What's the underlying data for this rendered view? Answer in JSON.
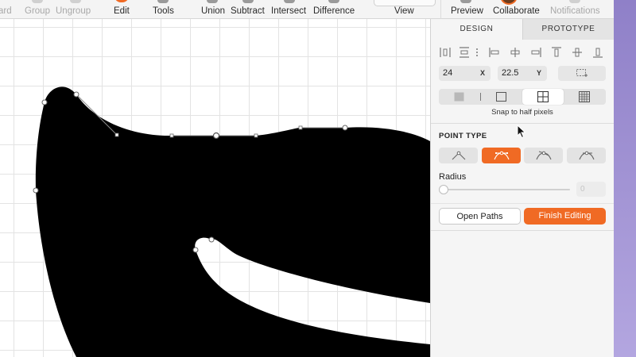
{
  "toolbar": {
    "items": [
      {
        "label": "ard",
        "state": "dim"
      },
      {
        "label": "Group",
        "state": "dim"
      },
      {
        "label": "Ungroup",
        "state": "dim"
      },
      {
        "label": "Edit",
        "state": "normal"
      },
      {
        "label": "Tools",
        "state": "normal"
      },
      {
        "label": "Union",
        "state": "normal"
      },
      {
        "label": "Subtract",
        "state": "normal"
      },
      {
        "label": "Intersect",
        "state": "normal"
      },
      {
        "label": "Difference",
        "state": "normal"
      },
      {
        "label": "View",
        "state": "normal"
      },
      {
        "label": "Preview",
        "state": "normal"
      },
      {
        "label": "Collaborate",
        "state": "normal"
      },
      {
        "label": "Notifications",
        "state": "dim"
      }
    ]
  },
  "inspector": {
    "tabs": {
      "design": "DESIGN",
      "prototype": "PROTOTYPE"
    },
    "position": {
      "x_value": "24",
      "x_label": "X",
      "y_value": "22.5",
      "y_label": "Y"
    },
    "pixel_hint": "Snap to half pixels",
    "point_type": {
      "title": "POINT TYPE",
      "selected_index": 1
    },
    "radius": {
      "label": "Radius",
      "value": "0",
      "slider_level": 0
    },
    "buttons": {
      "open_paths": "Open Paths",
      "finish_editing": "Finish Editing"
    }
  },
  "colors": {
    "accent": "#f06a24",
    "shape_fill": "#000000",
    "canvas_grid": "#e3e3e3",
    "panel_bg": "#f5f5f5"
  },
  "icons": {
    "alignment": [
      "distribute-horizontal-icon",
      "distribute-vertical-icon",
      "more-icon",
      "align-left-icon",
      "align-center-horizontal-icon",
      "align-right-icon",
      "align-top-icon",
      "align-center-vertical-icon",
      "align-bottom-icon"
    ],
    "pixel_grid": [
      "pixel-off-icon",
      "pixel-whole-icon",
      "pixel-half-icon",
      "pixel-subpixel-icon"
    ],
    "point_types": [
      "point-straight-icon",
      "point-mirrored-icon",
      "point-disconnected-icon",
      "point-asymmetric-icon"
    ]
  }
}
